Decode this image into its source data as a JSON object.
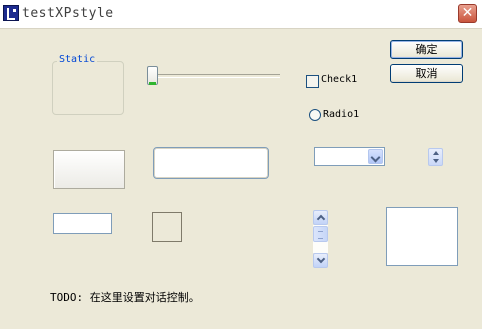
{
  "window": {
    "title": "testXPstyle",
    "close_symbol": "✕"
  },
  "buttons": {
    "ok_label": "确定",
    "cancel_label": "取消"
  },
  "controls": {
    "group_label": "Static",
    "checkbox_label": "Check1",
    "checkbox_checked": false,
    "radio_label": "Radio1",
    "radio_selected": false,
    "combo_value": "",
    "edit_small_value": "",
    "edit_large_value": "",
    "slider_value": 0
  },
  "footer": {
    "todo_text": "TODO: 在这里设置对话控制。"
  },
  "icons": {
    "app": "app-icon",
    "close": "close-icon",
    "combo_arrow": "chevron-down-icon",
    "spin_up": "chevron-up-icon",
    "spin_down": "chevron-down-icon"
  },
  "colors": {
    "background": "#ece9d8",
    "accent_border": "#003c74",
    "group_label": "#0046d5",
    "close_button": "#c9553d"
  }
}
